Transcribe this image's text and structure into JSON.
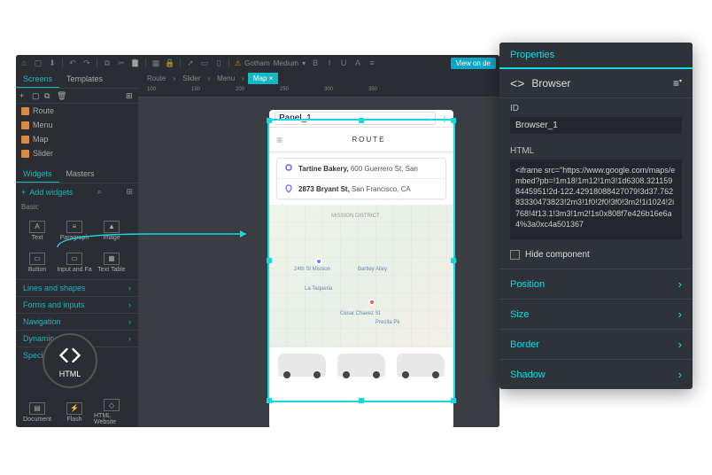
{
  "toolbar": {
    "font_family": "Gotham",
    "font_weight": "Medium",
    "view_btn": "View on de"
  },
  "left": {
    "tabs": [
      "Screens",
      "Templates"
    ],
    "tree": [
      "Route",
      "Menu",
      "Map",
      "Slider"
    ],
    "widget_tabs": [
      "Widgets",
      "Masters"
    ],
    "add_widgets": "Add widgets",
    "basic": "Basic",
    "widgets_row1": [
      "Text",
      "Paragraph",
      "Image"
    ],
    "widgets_row2": [
      "Button",
      "Input and Fa",
      "Text Table"
    ],
    "categories": [
      "Lines and shapes",
      "Forms and inputs",
      "Navigation",
      "Dynamic content",
      "Special co"
    ],
    "widgets_row3": [
      "Document",
      "Flash",
      "HTML Website"
    ]
  },
  "html_badge": "HTML",
  "breadcrumb": [
    "Route",
    "Slider",
    "Menu",
    "Map"
  ],
  "ruler": [
    "100",
    "150",
    "200",
    "250",
    "300",
    "350"
  ],
  "phone": {
    "panel_dd": "Panel_1",
    "route_title": "ROUTE",
    "addr1_name": "Tartine Bakery,",
    "addr1_rest": " 600 Guerrero St, San",
    "addr2_name": "2873 Bryant St,",
    "addr2_rest": " San Francisco, CA",
    "map_labels": {
      "mission": "MISSION DISTRICT",
      "st1": "24th St Mission",
      "st2": "Bartley Alley",
      "st3": "La Taqueria",
      "st4": "Cesar Chavez St",
      "st5": "Precita Pk"
    }
  },
  "props": {
    "header": "Properties",
    "browser": "Browser",
    "id_label": "ID",
    "id_value": "Browser_1",
    "html_label": "HTML",
    "html_value": "<iframe src=\"https://www.google.com/maps/embed?pb=!1m18!1m12!1m3!1d6308.3211598445951!2d-122.42918088427079!3d37.76283330473823!2m3!1f0!2f0!3f0!3m2!1i1024!2i768!4f13.1!3m3!1m2!1s0x808f7e426b16e6a4%3a0xc4a501367",
    "hide": "Hide component",
    "items": [
      "Position",
      "Size",
      "Border",
      "Shadow"
    ]
  }
}
